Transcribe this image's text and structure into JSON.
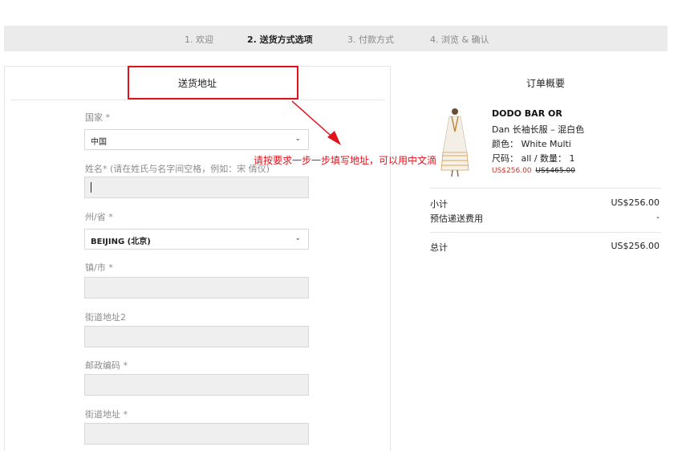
{
  "steps": [
    {
      "label": "1. 欢迎"
    },
    {
      "label": "2. 送货方式选项"
    },
    {
      "label": "3. 付款方式"
    },
    {
      "label": "4. 浏览 & 确认"
    }
  ],
  "shipping": {
    "title": "送货地址",
    "fields": {
      "country": {
        "label": "国家 *",
        "value": "中国"
      },
      "name": {
        "label": "姓名* (请在姓氏与名字间空格，例如：宋 倩仪)",
        "value": ""
      },
      "state": {
        "label": "州/省 *",
        "value": "BEIJING (北京)"
      },
      "city": {
        "label": "镇/市 *",
        "value": ""
      },
      "street2": {
        "label": "街道地址2",
        "value": ""
      },
      "postcode": {
        "label": "邮政编码 *",
        "value": ""
      },
      "street": {
        "label": "街道地址 *",
        "value": ""
      }
    }
  },
  "annotation": "请按要求一步一步填写地址，可以用中文滴",
  "summary": {
    "title": "订单概要",
    "product": {
      "brand": "DODO BAR OR",
      "name": "Dan 长袖长服 – 混白色",
      "color": "颜色： White Multi",
      "size_qty": "尺码： all / 数量： 1",
      "price": "US$256.00",
      "original_price": "US$465.00"
    },
    "subtotal_label": "小计",
    "subtotal_value": "US$256.00",
    "shipping_label": "预估递送费用",
    "shipping_value": "-",
    "total_label": "总计",
    "total_value": "US$256.00"
  },
  "colors": {
    "annotation": "#e0121c",
    "sale": "#c0392b"
  },
  "icons": {
    "select": "chevron-down-icon"
  }
}
